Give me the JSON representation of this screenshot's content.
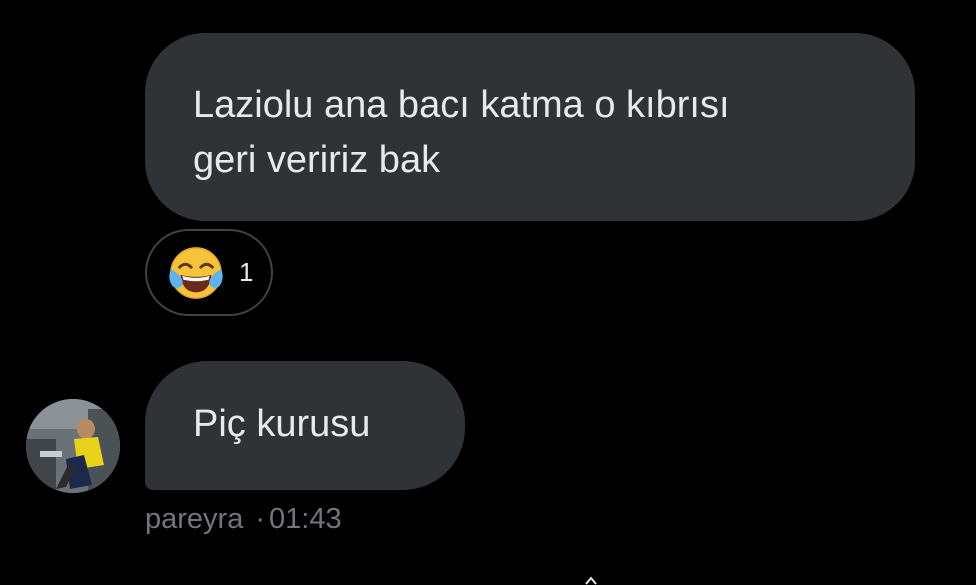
{
  "messages": [
    {
      "text_line1": "Laziolu ana bacı katma o kıbrısı",
      "text_line2": "geri veririz bak",
      "reaction": {
        "emoji": "face-with-tears-of-joy-icon",
        "count": "1"
      }
    },
    {
      "text": "Piç kurusu",
      "sender": "pareyra",
      "separator": "·",
      "time": "01:43"
    }
  ],
  "colors": {
    "background": "#000000",
    "bubble": "#2f3336",
    "text": "#e7e9ea",
    "meta_text": "#71767b",
    "reaction_border": "#3e4347"
  }
}
